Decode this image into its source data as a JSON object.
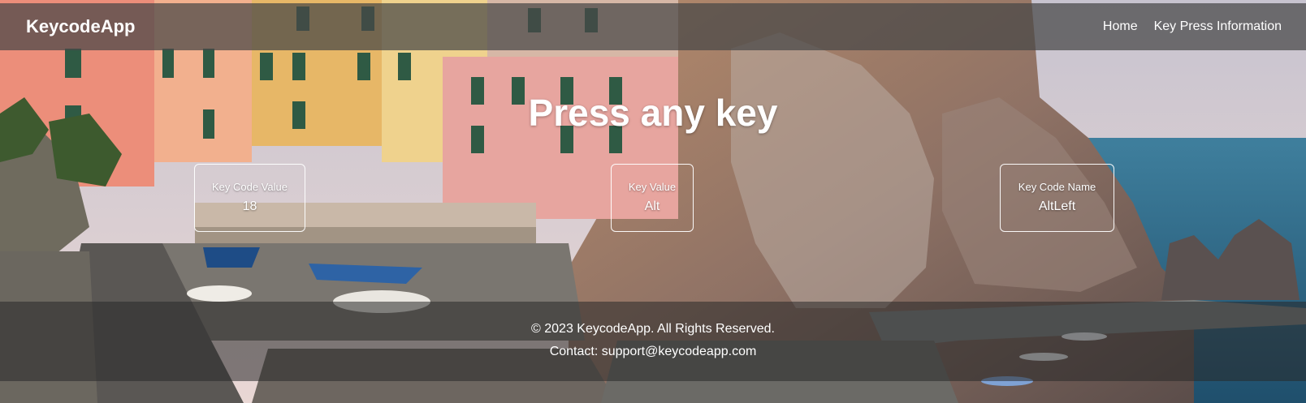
{
  "navbar": {
    "brand": "KeycodeApp",
    "links": [
      {
        "label": "Home"
      },
      {
        "label": "Key Press Information"
      }
    ]
  },
  "main": {
    "headline": "Press any key",
    "cards": [
      {
        "label": "Key Code Value",
        "value": "18"
      },
      {
        "label": "Key Value",
        "value": "Alt"
      },
      {
        "label": "Key Code Name",
        "value": "AltLeft"
      }
    ]
  },
  "footer": {
    "copyright": "© 2023 KeycodeApp. All Rights Reserved.",
    "contact": "Contact: support@keycodeapp.com"
  },
  "colors": {
    "text": "#ffffff",
    "navbar_bg": "rgba(70,70,70,0.72)",
    "footer_bg": "rgba(40,40,40,0.55)"
  }
}
